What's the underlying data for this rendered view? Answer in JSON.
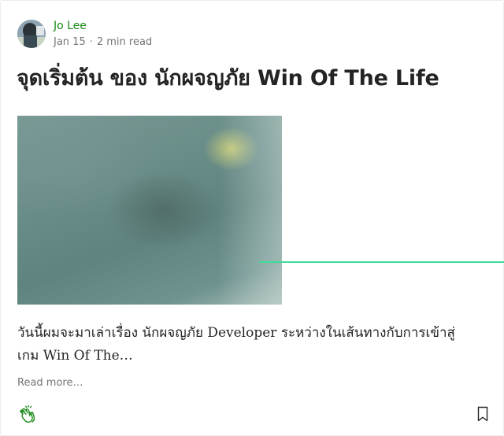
{
  "post": {
    "author": "Jo Lee",
    "date": "Jan 15",
    "separator": "·",
    "read_time": "2 min read",
    "title": "จุดเริ่มต้น ของ นักผจญภัย Win Of The Life",
    "excerpt": "วันนี้ผมจะมาเล่าเรื่อง นักผจญภัย Developer ระหว่างในเส้นทางกับการเข้าสู่เกม Win Of The…",
    "read_more": "Read more…"
  },
  "icons": {
    "clap": "clap-icon",
    "bookmark": "bookmark-icon"
  },
  "colors": {
    "author_link": "#1a8917",
    "accent_line": "#3ddc97",
    "clap_icon": "#1a8917"
  }
}
